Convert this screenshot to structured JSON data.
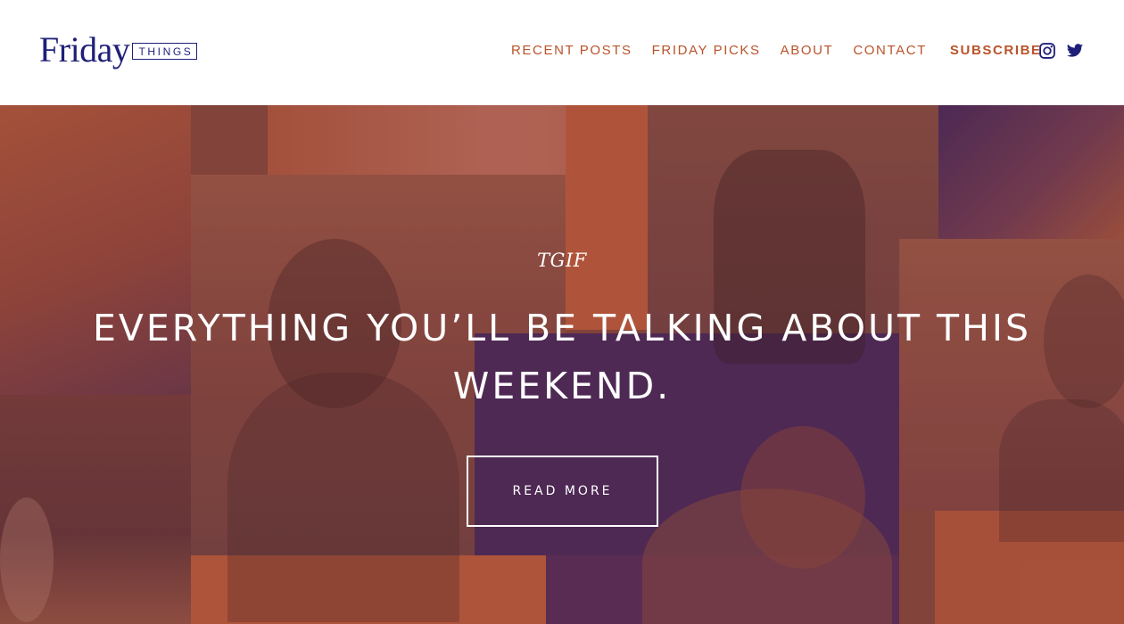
{
  "brand": {
    "logo_word": "Friday",
    "logo_box": "THINGS",
    "color_primary": "#1f1f78",
    "color_accent": "#b9532a"
  },
  "nav": {
    "items": [
      {
        "label": "RECENT POSTS"
      },
      {
        "label": "FRIDAY PICKS"
      },
      {
        "label": "ABOUT"
      },
      {
        "label": "CONTACT"
      },
      {
        "label": "SUBSCRIBE"
      }
    ]
  },
  "social": {
    "icons": [
      "instagram-icon",
      "twitter-icon"
    ]
  },
  "hero": {
    "kicker": "TGIF",
    "headline": "EVERYTHING YOU’LL BE TALKING ABOUT THIS WEEKEND.",
    "button_label": "READ MORE"
  }
}
